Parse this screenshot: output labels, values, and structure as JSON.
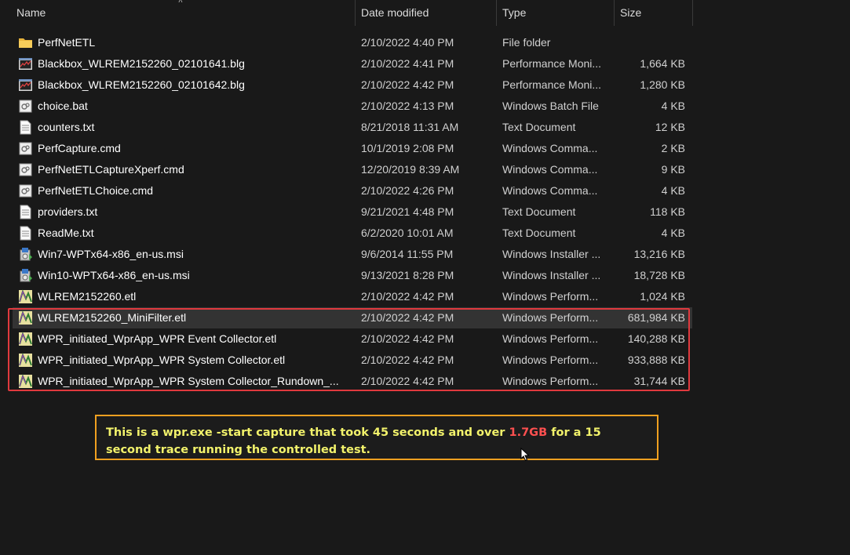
{
  "columns": {
    "name": "Name",
    "date": "Date modified",
    "type": "Type",
    "size": "Size"
  },
  "files": [
    {
      "name": "PerfNetETL",
      "date": "2/10/2022 4:40 PM",
      "type": "File folder",
      "size": "",
      "icon": "folder-icon"
    },
    {
      "name": "Blackbox_WLREM2152260_02101641.blg",
      "date": "2/10/2022 4:41 PM",
      "type": "Performance Moni...",
      "size": "1,664 KB",
      "icon": "perfmon-log-icon"
    },
    {
      "name": "Blackbox_WLREM2152260_02101642.blg",
      "date": "2/10/2022 4:42 PM",
      "type": "Performance Moni...",
      "size": "1,280 KB",
      "icon": "perfmon-log-icon"
    },
    {
      "name": "choice.bat",
      "date": "2/10/2022 4:13 PM",
      "type": "Windows Batch File",
      "size": "4 KB",
      "icon": "batch-file-icon"
    },
    {
      "name": "counters.txt",
      "date": "8/21/2018 11:31 AM",
      "type": "Text Document",
      "size": "12 KB",
      "icon": "text-file-icon"
    },
    {
      "name": "PerfCapture.cmd",
      "date": "10/1/2019 2:08 PM",
      "type": "Windows Comma...",
      "size": "2 KB",
      "icon": "batch-file-icon"
    },
    {
      "name": "PerfNetETLCaptureXperf.cmd",
      "date": "12/20/2019 8:39 AM",
      "type": "Windows Comma...",
      "size": "9 KB",
      "icon": "batch-file-icon"
    },
    {
      "name": "PerfNetETLChoice.cmd",
      "date": "2/10/2022 4:26 PM",
      "type": "Windows Comma...",
      "size": "4 KB",
      "icon": "batch-file-icon"
    },
    {
      "name": "providers.txt",
      "date": "9/21/2021 4:48 PM",
      "type": "Text Document",
      "size": "118 KB",
      "icon": "text-file-icon"
    },
    {
      "name": "ReadMe.txt",
      "date": "6/2/2020 10:01 AM",
      "type": "Text Document",
      "size": "4 KB",
      "icon": "text-file-icon"
    },
    {
      "name": "Win7-WPTx64-x86_en-us.msi",
      "date": "9/6/2014 11:55 PM",
      "type": "Windows Installer ...",
      "size": "13,216 KB",
      "icon": "installer-icon"
    },
    {
      "name": "Win10-WPTx64-x86_en-us.msi",
      "date": "9/13/2021 8:28 PM",
      "type": "Windows Installer ...",
      "size": "18,728 KB",
      "icon": "installer-icon"
    },
    {
      "name": "WLREM2152260.etl",
      "date": "2/10/2022 4:42 PM",
      "type": "Windows Perform...",
      "size": "1,024 KB",
      "icon": "etl-file-icon"
    },
    {
      "name": "WLREM2152260_MiniFilter.etl",
      "date": "2/10/2022 4:42 PM",
      "type": "Windows Perform...",
      "size": "681,984 KB",
      "icon": "etl-file-icon"
    },
    {
      "name": "WPR_initiated_WprApp_WPR Event Collector.etl",
      "date": "2/10/2022 4:42 PM",
      "type": "Windows Perform...",
      "size": "140,288 KB",
      "icon": "etl-file-icon"
    },
    {
      "name": "WPR_initiated_WprApp_WPR System Collector.etl",
      "date": "2/10/2022 4:42 PM",
      "type": "Windows Perform...",
      "size": "933,888 KB",
      "icon": "etl-file-icon"
    },
    {
      "name": "WPR_initiated_WprApp_WPR System Collector_Rundown_...",
      "date": "2/10/2022 4:42 PM",
      "type": "Windows Perform...",
      "size": "31,744 KB",
      "icon": "etl-file-icon"
    }
  ],
  "hovered_row": 13,
  "callout": {
    "text_before": "This is a wpr.exe -start capture that took 45 seconds and over ",
    "highlight": "1.7GB",
    "text_after": " for a 15 second trace running the controlled test.",
    "accent_color": "#ff5050",
    "text_color": "#f2f26b",
    "border_color": "#f0a020"
  },
  "highlight_box_color": "#e0393e"
}
